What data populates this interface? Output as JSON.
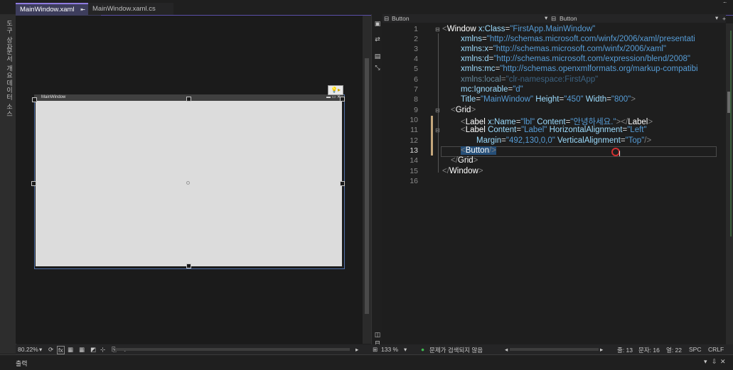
{
  "tabs": [
    {
      "label": "MainWindow.xaml",
      "pin": "⇤",
      "close": "●"
    },
    {
      "label": "MainWindow.xaml.cs"
    }
  ],
  "left_strip": [
    "도구 상자",
    "문서 개요",
    "데이터 소스"
  ],
  "designer": {
    "window_title": "MainWindow",
    "zoom": "80.22%"
  },
  "code_header": {
    "left_dropdown": "Button",
    "right_dropdown": "Button"
  },
  "code_lines": [
    {
      "n": "1"
    },
    {
      "n": "2"
    },
    {
      "n": "3"
    },
    {
      "n": "4"
    },
    {
      "n": "5"
    },
    {
      "n": "6"
    },
    {
      "n": "7"
    },
    {
      "n": "8"
    },
    {
      "n": "9"
    },
    {
      "n": "10"
    },
    {
      "n": "11"
    },
    {
      "n": "12"
    },
    {
      "n": "13"
    },
    {
      "n": "14"
    },
    {
      "n": "15"
    },
    {
      "n": "16"
    }
  ],
  "code": {
    "l1_el": "Window",
    "l1_attr": "x:Class",
    "l1_val": "\"FirstApp.MainWindow\"",
    "l2_attr": "xmlns",
    "l2_val": "\"http://schemas.microsoft.com/winfx/2006/xaml/presentati",
    "l3_attr": "xmlns:x",
    "l3_val": "\"http://schemas.microsoft.com/winfx/2006/xaml\"",
    "l4_attr": "xmlns:d",
    "l4_val": "\"http://schemas.microsoft.com/expression/blend/2008\"",
    "l5_attr": "xmlns:mc",
    "l5_val": "\"http://schemas.openxmlformats.org/markup-compatibi",
    "l6_attr": "xmlns:local",
    "l6_val": "\"clr-namespace:FirstApp\"",
    "l7_attr": "mc:Ignorable",
    "l7_val": "\"d\"",
    "l8_attr1": "Title",
    "l8_val1": "\"MainWindow\"",
    "l8_attr2": "Height",
    "l8_val2": "\"450\"",
    "l8_attr3": "Width",
    "l8_val3": "\"800\"",
    "l9_el": "Grid",
    "l10_el": "Label",
    "l10_attr1": "x:Name",
    "l10_val1": "\"lbl\"",
    "l10_attr2": "Content",
    "l10_val2": "\"안녕하세요.\"",
    "l11_el": "Label",
    "l11_attr1": "Content",
    "l11_val1": "\"Label\"",
    "l11_attr2": "HorizontalAlignment",
    "l11_val2": "\"Left\"",
    "l12_attr1": "Margin",
    "l12_val1": "\"492,130,0,0\"",
    "l12_attr2": "VerticalAlignment",
    "l12_val2": "\"Top\"",
    "l13_el": "Button",
    "l14_el": "Grid",
    "l15_el": "Window"
  },
  "status": {
    "zoom": "133 %",
    "issues": "문제가 검색되지 않음",
    "line": "줄: 13",
    "char": "문자: 16",
    "col": "열: 22",
    "spc": "SPC",
    "crlf": "CRLF"
  },
  "output": {
    "label": "출력"
  },
  "colors": {
    "accent": "#8f7be0",
    "selection": "#264f78",
    "issues_ok": "#3fb950"
  }
}
